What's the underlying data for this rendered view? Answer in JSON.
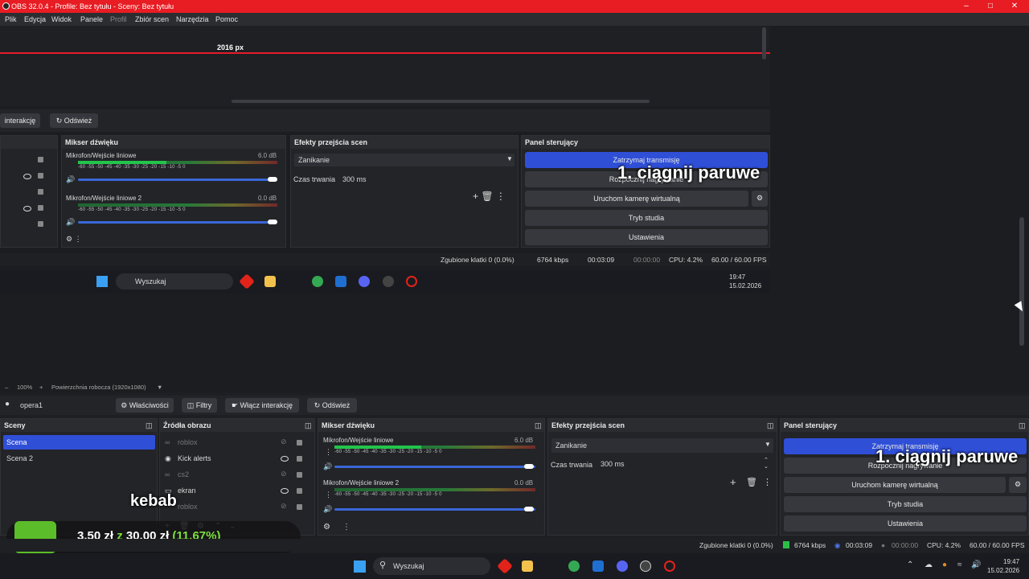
{
  "window": {
    "title": "OBS 32.0.4 - Profile: Bez tytułu - Sceny: Bez tytułu"
  },
  "menu": [
    {
      "label": "Plik",
      "enabled": true
    },
    {
      "label": "Edycja",
      "enabled": true
    },
    {
      "label": "Widok",
      "enabled": true
    },
    {
      "label": "Panele",
      "enabled": true
    },
    {
      "label": "Profil",
      "enabled": false
    },
    {
      "label": "Zbiór scen",
      "enabled": true
    },
    {
      "label": "Narzędzia",
      "enabled": true
    },
    {
      "label": "Pomoc",
      "enabled": true
    }
  ],
  "nested": {
    "px_label": "2016 px",
    "toolbar": {
      "interact": "interakcję",
      "refresh": "Odśwież"
    },
    "mixer": {
      "title": "Mikser dźwięku",
      "channels": [
        {
          "name": "Mikrofon/Wejście liniowe",
          "db": "6.0 dB"
        },
        {
          "name": "Mikrofon/Wejście liniowe 2",
          "db": "0.0 dB"
        }
      ],
      "ticks": "-60  -55  -50  -45  -40  -35  -30  -25  -20  -15  -10   -5   0"
    },
    "transitions": {
      "title": "Efekty przejścia scen",
      "effect": "Zanikanie",
      "duration_label": "Czas trwania",
      "duration": "300 ms"
    },
    "controls": {
      "title": "Panel sterujący",
      "buttons": [
        "Zatrzymaj transmisję",
        "Rozpocznij nagrywanie",
        "Uruchom kamerę wirtualną",
        "Tryb studia",
        "Ustawienia"
      ]
    },
    "status": {
      "dropped": "Zgubione klatki 0 (0.0%)",
      "kbps": "6764 kbps",
      "stream_time": "00:03:09",
      "rec_time": "00:00:00",
      "cpu": "CPU: 4.2%",
      "fps": "60.00 / 60.00 FPS"
    },
    "overlay": "1. ciągnij paruwe",
    "taskbar": {
      "search": "Wyszukaj",
      "time": "19:47",
      "date": "15.02.2026"
    }
  },
  "canvas": {
    "zoom": "100%",
    "label": "Powierzchnia robocza (1920x1080)"
  },
  "source_toolbar": {
    "source": "opera1",
    "properties": "Właściwości",
    "filters": "Filtry",
    "interact": "Włącz interakcję",
    "refresh": "Odśwież"
  },
  "scenes": {
    "title": "Sceny",
    "items": [
      "Scena",
      "Scena 2"
    ],
    "selected": 0
  },
  "sources": {
    "title": "Źródła obrazu",
    "items": [
      "roblox",
      "Kick alerts",
      "cs2",
      "ekran",
      "roblox"
    ]
  },
  "mixer": {
    "title": "Mikser dźwięku",
    "channels": [
      {
        "name": "Mikrofon/Wejście liniowe",
        "db": "6.0 dB"
      },
      {
        "name": "Mikrofon/Wejście liniowe 2",
        "db": "0.0 dB"
      }
    ],
    "ticks": "-60  -55  -50  -45  -40  -35  -30  -25  -20  -15  -10   -5   0"
  },
  "transitions": {
    "title": "Efekty przejścia scen",
    "effect": "Zanikanie",
    "duration_label": "Czas trwania",
    "duration": "300 ms"
  },
  "controls": {
    "title": "Panel sterujący",
    "buttons": [
      "Zatrzymaj transmisję",
      "Rozpocznij nagrywanie",
      "Uruchom kamerę wirtualną",
      "Tryb studia",
      "Ustawienia"
    ]
  },
  "overlay": {
    "text": "1. ciągnij paruwe",
    "kebab": "kebab",
    "goal_a": "3,50 zł",
    "goal_z": "z",
    "goal_b": "30,00 zł",
    "goal_pct": "(11.67%)",
    "goal_color": "#7ee03a"
  },
  "status": {
    "dropped": "Zgubione klatki 0 (0.0%)",
    "kbps": "6764 kbps",
    "stream_time": "00:03:09",
    "rec_time": "00:00:00",
    "cpu": "CPU: 4.2%",
    "fps": "60.00 / 60.00 FPS"
  },
  "taskbar": {
    "search": "Wyszukaj",
    "time": "19:47",
    "date": "15.02.2026"
  },
  "colors": {
    "accent": "#2f4fd7",
    "titlebar": "#e81c23"
  }
}
